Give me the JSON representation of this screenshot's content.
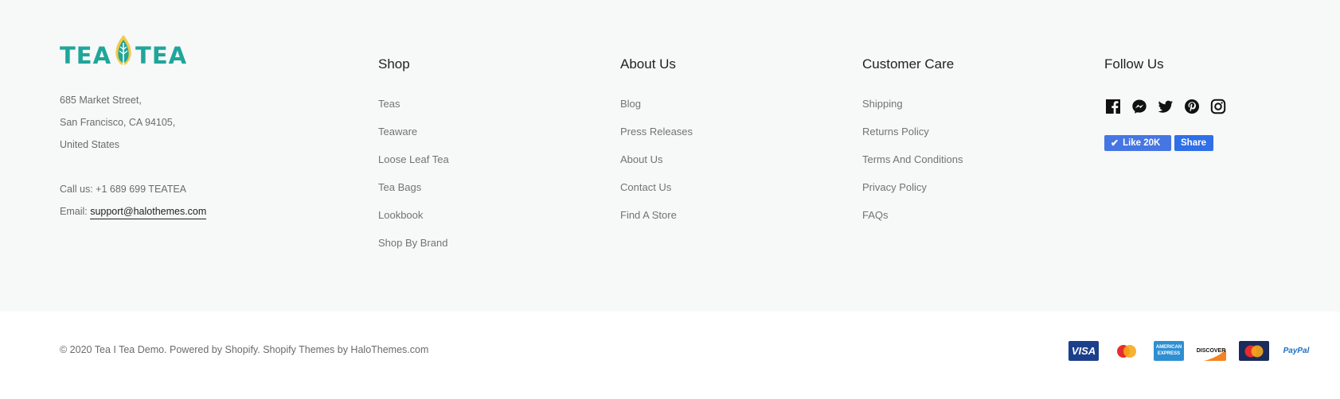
{
  "logo": {
    "left": "TEA",
    "right": "TEA"
  },
  "address": {
    "line1": "685 Market Street,",
    "line2": "San Francisco, CA 94105,",
    "line3": "United States",
    "call": "Call us: +1 689 699 TEATEA",
    "email_label": "Email: ",
    "email": "support@halothemes.com"
  },
  "columns": [
    {
      "title": "Shop",
      "links": [
        "Teas",
        "Teaware",
        "Loose Leaf Tea",
        "Tea Bags",
        "Lookbook",
        "Shop By Brand"
      ]
    },
    {
      "title": "About Us",
      "links": [
        "Blog",
        "Press Releases",
        "About Us",
        "Contact Us",
        "Find A Store"
      ]
    },
    {
      "title": "Customer Care",
      "links": [
        "Shipping",
        "Returns Policy",
        "Terms And Conditions",
        "Privacy Policy",
        "FAQs"
      ]
    }
  ],
  "follow": {
    "title": "Follow Us",
    "icons": [
      "facebook-icon",
      "messenger-icon",
      "twitter-icon",
      "pinterest-icon",
      "instagram-icon"
    ],
    "like_label": "Like 20K",
    "share_label": "Share"
  },
  "copyright": "© 2020 Tea I Tea Demo. Powered by Shopify. Shopify Themes by HaloThemes.com",
  "payments": {
    "visa": "VISA",
    "amex_top": "AMERICAN",
    "amex_bottom": "EXPRESS",
    "discover": "DISCOVER",
    "paypal": "PayPal"
  },
  "colors": {
    "brand": "#1fa69a",
    "footer_bg": "#f7f8f8",
    "fb_blue": "#4676e3"
  }
}
